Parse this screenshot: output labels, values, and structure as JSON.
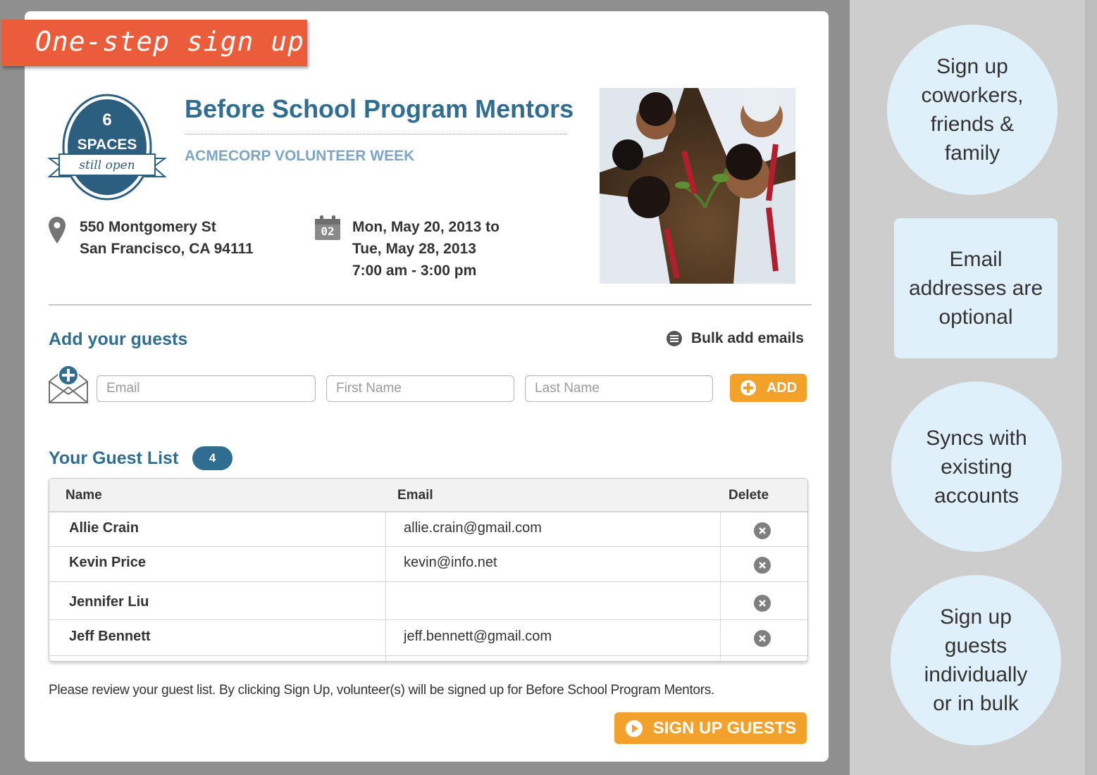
{
  "ribbon": {
    "text": "One-step sign up"
  },
  "badge": {
    "count": "6",
    "spaces_label": "SPACES",
    "status": "still open"
  },
  "event": {
    "title": "Before School Program Mentors",
    "organization": "ACMECORP VOLUNTEER WEEK",
    "address_line1": "550 Montgomery St",
    "address_line2": "San Francisco, CA 94111",
    "calendar_day": "02",
    "date_line1": "Mon, May 20, 2013 to",
    "date_line2": "Tue, May 28, 2013",
    "time_line": "7:00 am - 3:00 pm"
  },
  "add_guests": {
    "heading": "Add your guests",
    "bulk_label": "Bulk add emails",
    "email_placeholder": "Email",
    "first_name_placeholder": "First Name",
    "last_name_placeholder": "Last Name",
    "add_label": "ADD"
  },
  "guest_list": {
    "heading": "Your Guest List",
    "count": "4",
    "columns": {
      "name": "Name",
      "email": "Email",
      "delete": "Delete"
    },
    "rows": [
      {
        "name": "Allie Crain",
        "email": "allie.crain@gmail.com"
      },
      {
        "name": "Kevin Price",
        "email": "kevin@info.net"
      },
      {
        "name": "Jennifer Liu",
        "email": ""
      },
      {
        "name": "Jeff Bennett",
        "email": "jeff.bennett@gmail.com"
      }
    ]
  },
  "footer": {
    "notice": "Please review your guest list. By clicking Sign Up, volunteer(s) will be signed up for Before School Program Mentors.",
    "signup_label": "SIGN UP GUESTS"
  },
  "callouts": [
    {
      "lines": [
        "Sign up",
        "coworkers,",
        "friends &",
        "family"
      ]
    },
    {
      "lines": [
        "Email",
        "addresses are",
        "optional"
      ]
    },
    {
      "lines": [
        "Syncs with",
        "existing",
        "accounts"
      ]
    },
    {
      "lines": [
        "Sign up",
        "guests",
        "individually",
        "or in bulk"
      ]
    }
  ],
  "colors": {
    "ribbon": "#ea5c3a",
    "primary_blue": "#2f6e91",
    "accent_orange": "#f2a12b",
    "callout_bg": "#dff0fa"
  },
  "icons": {
    "location": "location-pin-icon",
    "calendar": "calendar-icon",
    "bulk": "list-icon",
    "envelope": "envelope-add-icon",
    "add": "plus-circle-icon",
    "delete": "close-circle-icon",
    "signup": "play-circle-icon"
  }
}
